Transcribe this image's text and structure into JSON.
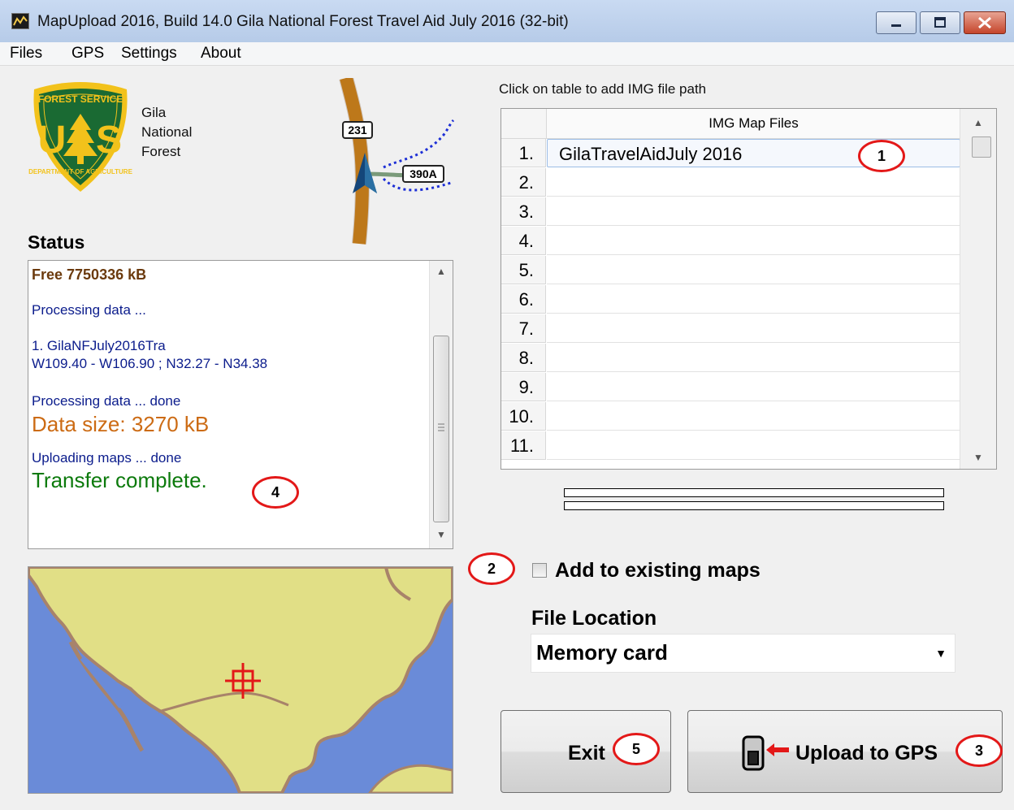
{
  "window": {
    "title": "MapUpload 2016, Build 14.0  Gila National Forest Travel Aid July 2016 (32-bit)",
    "min_symbol": "—",
    "max_symbol": "▫",
    "close_symbol": "✕"
  },
  "menu": [
    "Files",
    "GPS",
    "Settings",
    "About"
  ],
  "logo": {
    "top_text": "FOREST SERVICE",
    "bottom_text": "DEPARTMENT OF AGRICULTURE",
    "left_letter": "U",
    "right_letter": "S",
    "forest_name": [
      "Gila",
      "National",
      "Forest"
    ]
  },
  "road_map": {
    "route_a": "231",
    "route_b": "390A"
  },
  "status": {
    "label": "Status",
    "free": "Free 7750336 kB",
    "processing": "Processing data ...",
    "file_line": "1. GilaNFJuly2016Tra",
    "bounds_line": " W109.40 - W106.90  ;  N32.27 - N34.38",
    "processing_done": "Processing data ... done",
    "data_size": "Data size: 3270 kB",
    "uploading_done": "Uploading maps ... done",
    "transfer_complete": "Transfer complete."
  },
  "table": {
    "hint": "Click on table to add IMG file path",
    "header": "IMG Map Files",
    "rows": [
      {
        "num": "1.",
        "file": "GilaTravelAidJuly 2016"
      },
      {
        "num": "2.",
        "file": ""
      },
      {
        "num": "3.",
        "file": ""
      },
      {
        "num": "4.",
        "file": ""
      },
      {
        "num": "5.",
        "file": ""
      },
      {
        "num": "6.",
        "file": ""
      },
      {
        "num": "7.",
        "file": ""
      },
      {
        "num": "8.",
        "file": ""
      },
      {
        "num": "9.",
        "file": ""
      },
      {
        "num": "10.",
        "file": ""
      },
      {
        "num": "11.",
        "file": ""
      }
    ]
  },
  "options": {
    "add_existing_label": "Add to existing maps",
    "add_existing_checked": false,
    "file_location_label": "File Location",
    "file_location_value": "Memory card"
  },
  "buttons": {
    "exit": "Exit",
    "upload": "Upload to GPS"
  },
  "annotations": [
    "1",
    "2",
    "3",
    "4",
    "5"
  ],
  "colors": {
    "status_blue": "#0b1c8c",
    "status_brown": "#6b3a0d",
    "data_size_orange": "#cc6b14",
    "transfer_green": "#0c7a0c",
    "annotation_red": "#e31818",
    "map_land": "#e1df86",
    "map_border": "#a8836a",
    "map_water": "#6a8bd8",
    "crosshair": "#e31818"
  }
}
